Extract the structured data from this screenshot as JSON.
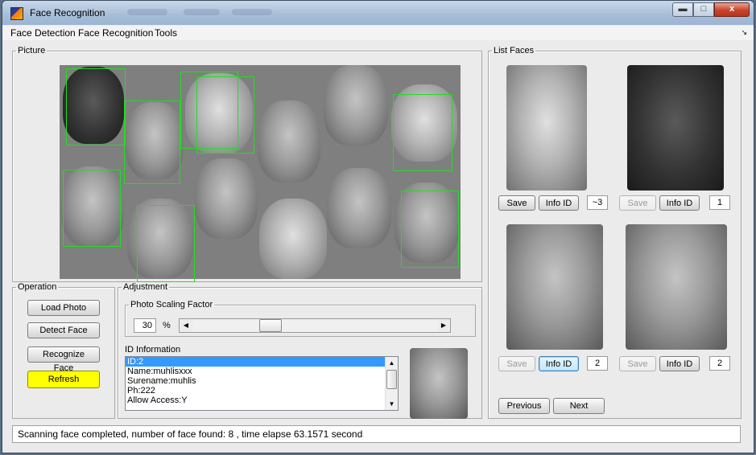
{
  "window": {
    "title": "Face Recognition",
    "minimize_glyph": "▬",
    "maximize_glyph": "□",
    "close_glyph": "x"
  },
  "menu": {
    "items": [
      "Face Detection",
      "Face Recognition",
      "Tools"
    ],
    "overflow_glyph": "↘"
  },
  "picture_panel": {
    "legend": "Picture"
  },
  "list_faces": {
    "legend": "List Faces",
    "cards": [
      {
        "save_label": "Save",
        "save_enabled": true,
        "info_label": "Info ID",
        "id_value": "~3"
      },
      {
        "save_label": "Save",
        "save_enabled": false,
        "info_label": "Info ID",
        "id_value": "1"
      },
      {
        "save_label": "Save",
        "save_enabled": false,
        "info_label": "Info ID",
        "id_value": "2"
      },
      {
        "save_label": "Save",
        "save_enabled": false,
        "info_label": "Info ID",
        "id_value": "2"
      }
    ],
    "previous_label": "Previous",
    "next_label": "Next"
  },
  "operation": {
    "legend": "Operation",
    "load_photo_label": "Load Photo",
    "detect_face_label": "Detect Face",
    "recognize_face_label": "Recognize Face",
    "refresh_label": "Refresh",
    "refresh_color": "#ffff00"
  },
  "adjustment": {
    "legend": "Adjustment",
    "scaling": {
      "legend": "Photo Scaling Factor",
      "value": "30",
      "unit": "%",
      "slider_fraction": 0.3
    },
    "id_info": {
      "label": "ID Information",
      "rows": [
        "ID:2",
        "Name:muhlisxxx",
        "Surename:muhlis",
        "Ph:222",
        "Allow Access:Y"
      ],
      "selected_index": 0
    }
  },
  "status": {
    "text": "Scanning face completed, number of face found: 8 , time elapse 63.1571 second"
  },
  "colors": {
    "detection_box": "#22dd22",
    "selection": "#3399ff"
  }
}
